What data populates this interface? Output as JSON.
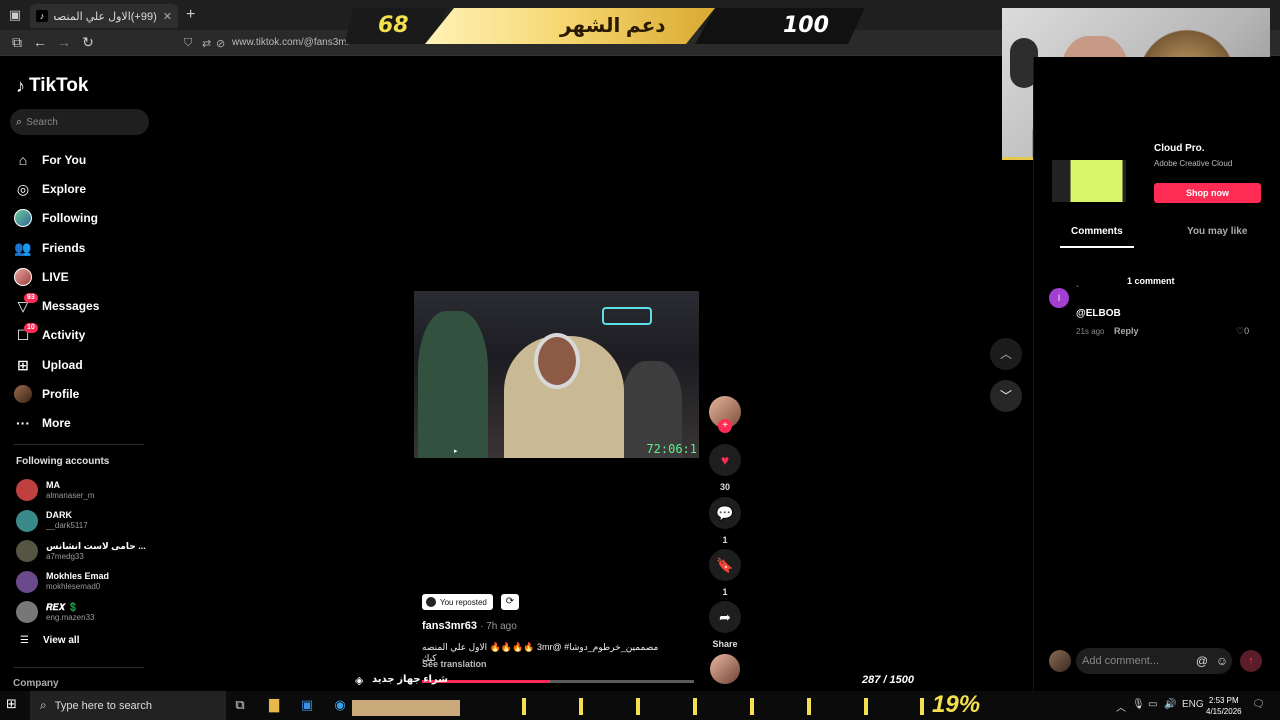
{
  "browser": {
    "tab_title": "(99+)الاول علي المنصه كيك 🔥",
    "tab_favicon": "tiktok-icon",
    "url": "www.tiktok.com/@fans3mr"
  },
  "stream_overlay": {
    "left_number": "68",
    "goal_label": "دعم الشهر",
    "right_number": "100",
    "bottom_label": "شراء جهاز جديد",
    "bottom_progress": "287 / 1500",
    "percent": "19%"
  },
  "sidebar": {
    "logo": "TikTok",
    "search_placeholder": "Search",
    "menu": [
      {
        "label": "For You",
        "icon": "home-icon"
      },
      {
        "label": "Explore",
        "icon": "compass-icon"
      },
      {
        "label": "Following",
        "icon": "avatar"
      },
      {
        "label": "Friends",
        "icon": "friends-icon"
      },
      {
        "label": "LIVE",
        "icon": "avatar"
      },
      {
        "label": "Messages",
        "icon": "messages-icon",
        "badge": "93"
      },
      {
        "label": "Activity",
        "icon": "activity-icon",
        "badge": "10"
      },
      {
        "label": "Upload",
        "icon": "upload-icon"
      },
      {
        "label": "Profile",
        "icon": "avatar"
      },
      {
        "label": "More",
        "icon": "more-icon"
      }
    ],
    "following_title": "Following accounts",
    "following": [
      {
        "name": "MA",
        "handle": "almanaser_m",
        "color": "#c04040"
      },
      {
        "name": "DARK",
        "handle": "__dark5117",
        "color": "#3a8a8a"
      },
      {
        "name": "حامى لاست انشانس ...",
        "handle": "a7medg33",
        "color": "#555544"
      },
      {
        "name": "Mokhles Emad",
        "handle": "mokhlesemad0",
        "color": "#6a4a8a"
      },
      {
        "name": "𝑹𝑬𝑿 💲",
        "handle": "eng.mazen33",
        "color": "#777777"
      }
    ],
    "view_all": "View all",
    "company": "Company"
  },
  "video": {
    "timer": "72:06:1",
    "reposted": "You reposted",
    "author": "fans3mr63",
    "ago": "· 7h ago",
    "description": "مصممين_خرطوم_دوشا# @3mr 🔥🔥🔥🔥 الاول علي المنصه كيك",
    "see_translation": "See translation",
    "progress": 0.47,
    "likes": "30",
    "comments": "1",
    "saves": "1",
    "share_label": "Share"
  },
  "ad": {
    "title": "Cloud Pro.",
    "subtitle": "Adobe Creative Cloud",
    "button": "Shop now"
  },
  "comments_panel": {
    "tab_comments": "Comments",
    "tab_like": "You may like",
    "count": "1 comment",
    "items": [
      {
        "avatar_letter": "l",
        "user": "`",
        "text": "@ELBOB",
        "time": "21s ago",
        "reply": "Reply",
        "likes": "0"
      }
    ],
    "add_placeholder": "Add comment..."
  },
  "taskbar": {
    "search_placeholder": "Type here to search",
    "lang": "ENG",
    "time": "2:53 PM",
    "date": "4/15/2026"
  },
  "colors": {
    "accent": "#fe2c55",
    "overlay_yellow": "#f4e04d"
  }
}
